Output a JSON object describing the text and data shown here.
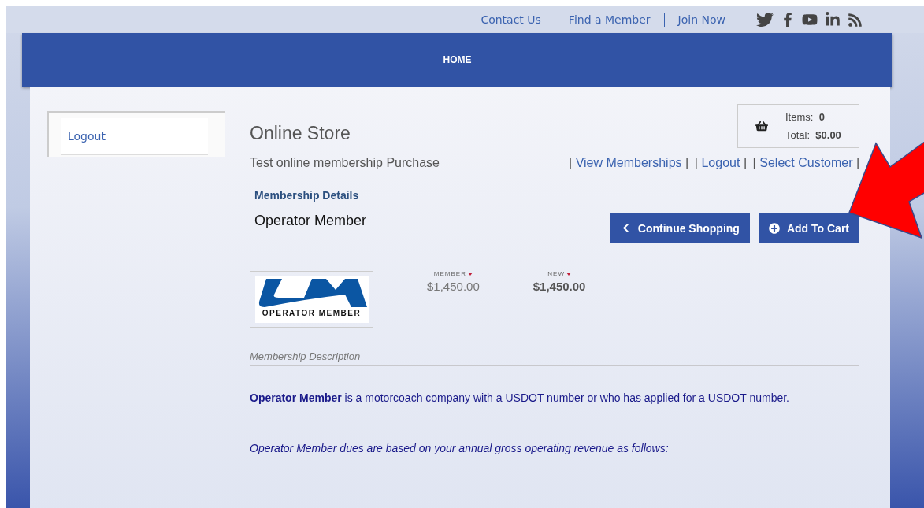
{
  "top_links": [
    "Contact Us",
    "Find a Member",
    "Join Now"
  ],
  "nav": {
    "items": [
      "HOME"
    ]
  },
  "sidebar": {
    "items": [
      "Logout"
    ]
  },
  "store": {
    "title": "Online Store",
    "subtitle": "Test online membership Purchase",
    "links": [
      {
        "open": "[",
        "label": "View Memberships",
        "close": "]"
      },
      {
        "open": "[",
        "label": "Logout",
        "close": "]"
      },
      {
        "open": "[",
        "label": "Select Customer",
        "close": "]"
      }
    ],
    "cart": {
      "items_label": "Items:",
      "items": "0",
      "total_label": "Total:",
      "total": "$0.00"
    }
  },
  "details": {
    "heading": "Membership Details",
    "product": "Operator Member",
    "buttons": [
      {
        "kind": "back",
        "label": "Continue Shopping"
      },
      {
        "kind": "add",
        "label": "Add To Cart"
      }
    ],
    "logo_caption": "OPERATOR MEMBER",
    "prices": [
      {
        "label": "MEMBER",
        "amount": "$1,450.00",
        "struck": true
      },
      {
        "label": "NEW",
        "amount": "$1,450.00",
        "struck": false
      }
    ],
    "description_heading": "Membership Description",
    "paragraphs": [
      {
        "kind": "plain",
        "text": "**Operator Member** is a motorcoach company with a USDOT number or who has applied for a USDOT number."
      },
      {
        "kind": "italic",
        "text": "Operator Member dues are based on your annual gross operating revenue as follows:"
      }
    ]
  }
}
